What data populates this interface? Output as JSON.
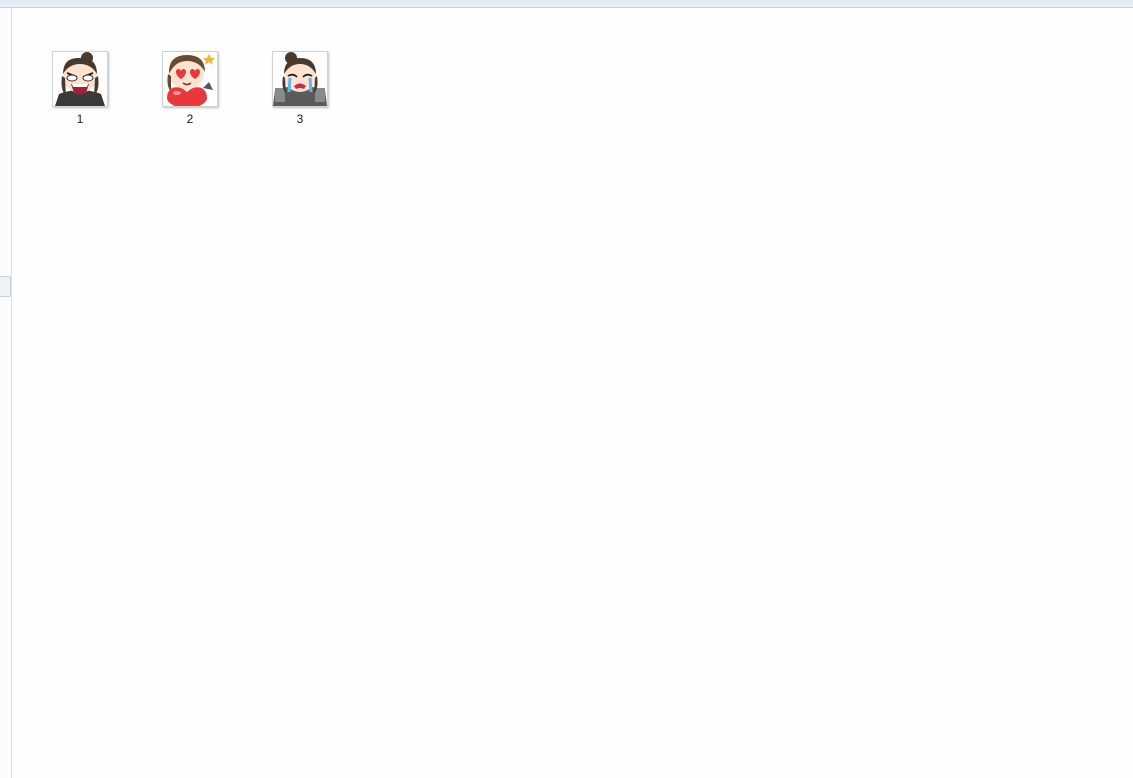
{
  "files": [
    {
      "name": "1",
      "thumbnail": "angry-character-icon"
    },
    {
      "name": "2",
      "thumbnail": "heart-eyes-character-icon"
    },
    {
      "name": "3",
      "thumbnail": "crying-character-icon"
    }
  ],
  "colors": {
    "background": "#fdfefd",
    "hair": "#4a3a2e",
    "skin": "#fde3cf",
    "heart": "#e8383c"
  }
}
